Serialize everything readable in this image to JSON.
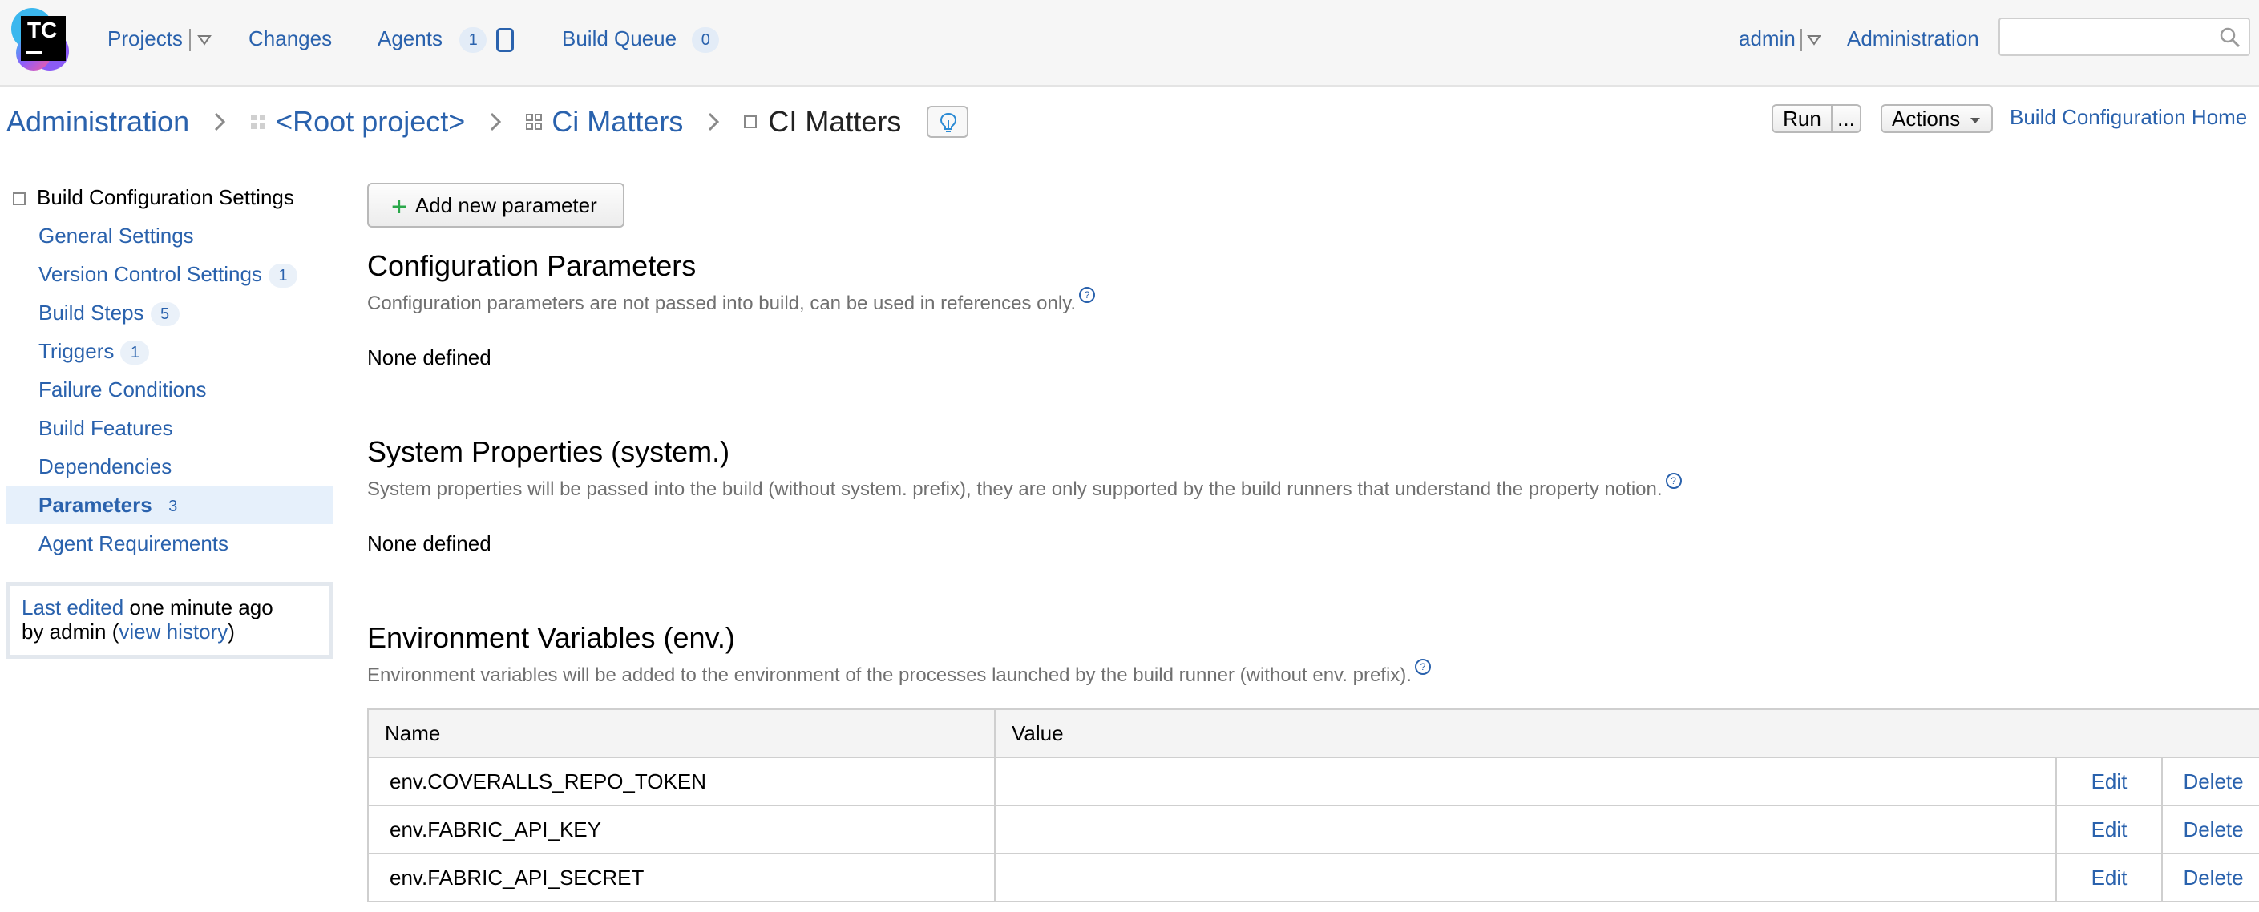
{
  "logo": {
    "text": "TC"
  },
  "topnav": {
    "projects": "Projects",
    "changes": "Changes",
    "agents": "Agents",
    "agents_count": "1",
    "build_queue": "Build Queue",
    "build_queue_count": "0",
    "user": "admin",
    "administration": "Administration",
    "search_placeholder": ""
  },
  "breadcrumb": {
    "items": [
      "Administration",
      "<Root project>",
      "Ci Matters",
      "CI Matters"
    ]
  },
  "actions": {
    "run": "Run",
    "run_more": "...",
    "actions": "Actions",
    "home": "Build Configuration Home"
  },
  "sidebar": {
    "heading": "Build Configuration Settings",
    "items": [
      {
        "label": "General Settings",
        "count": ""
      },
      {
        "label": "Version Control Settings",
        "count": "1"
      },
      {
        "label": "Build Steps",
        "count": "5"
      },
      {
        "label": "Triggers",
        "count": "1"
      },
      {
        "label": "Failure Conditions",
        "count": ""
      },
      {
        "label": "Build Features",
        "count": ""
      },
      {
        "label": "Dependencies",
        "count": ""
      },
      {
        "label": "Parameters",
        "count": "3"
      },
      {
        "label": "Agent Requirements",
        "count": ""
      }
    ],
    "last_edited": {
      "link": "Last edited",
      "time": " one minute ago",
      "by": "by admin  (",
      "history_link": "view history",
      "close": ")"
    }
  },
  "main": {
    "add_button": "Add new parameter",
    "config": {
      "title": "Configuration Parameters",
      "desc": "Configuration parameters are not passed into build, can be used in references only.",
      "empty": "None defined"
    },
    "system": {
      "title": "System Properties (system.)",
      "desc": "System properties will be passed into the build (without system. prefix), they are only supported by the build runners that understand the property notion.",
      "empty": "None defined"
    },
    "env": {
      "title": "Environment Variables (env.)",
      "desc": "Environment variables will be added to the environment of the processes launched by the build runner (without env. prefix).",
      "columns": [
        "Name",
        "Value"
      ],
      "rows": [
        {
          "name": "env.COVERALLS_REPO_TOKEN",
          "value": "",
          "edit": "Edit",
          "delete": "Delete"
        },
        {
          "name": "env.FABRIC_API_KEY",
          "value": "",
          "edit": "Edit",
          "delete": "Delete"
        },
        {
          "name": "env.FABRIC_API_SECRET",
          "value": "",
          "edit": "Edit",
          "delete": "Delete"
        }
      ]
    }
  },
  "colors": {
    "link": "#2a62ad",
    "active_bg": "#e6f0fb",
    "add_plus": "#2aa84a"
  }
}
